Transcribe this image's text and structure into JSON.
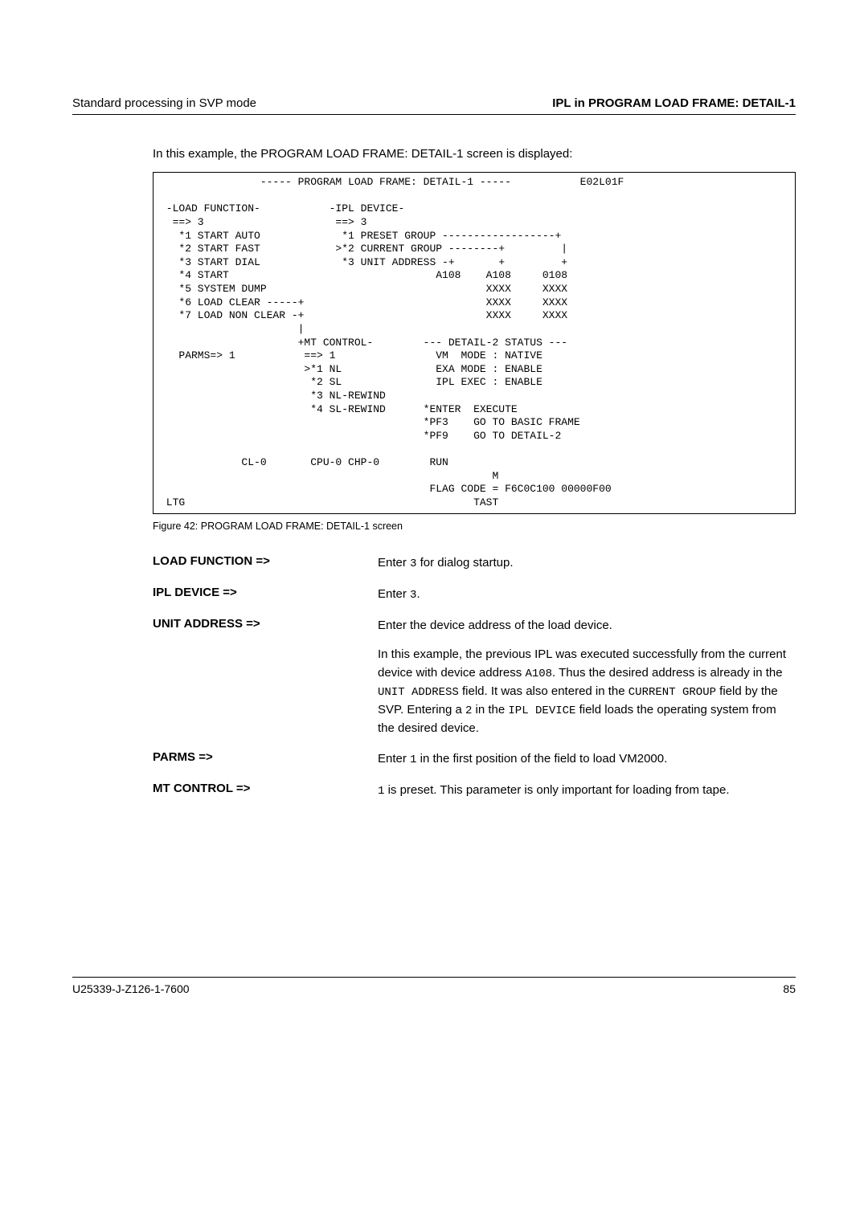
{
  "header": {
    "left": "Standard processing in SVP mode",
    "right": "IPL in PROGRAM LOAD FRAME: DETAIL-1"
  },
  "intro": "In this example, the PROGRAM LOAD FRAME: DETAIL-1 screen is displayed:",
  "terminal": "                ----- PROGRAM LOAD FRAME: DETAIL-1 -----           E02L01F\n\n -LOAD FUNCTION-           -IPL DEVICE-\n  ==> 3                     ==> 3\n   *1 START AUTO             *1 PRESET GROUP ------------------+\n   *2 START FAST            >*2 CURRENT GROUP --------+         |\n   *3 START DIAL             *3 UNIT ADDRESS -+       +         +\n   *4 START                                 A108    A108     0108\n   *5 SYSTEM DUMP                                   XXXX     XXXX\n   *6 LOAD CLEAR -----+                             XXXX     XXXX\n   *7 LOAD NON CLEAR -+                             XXXX     XXXX\n                      |\n                      +MT CONTROL-        --- DETAIL-2 STATUS ---\n   PARMS=> 1           ==> 1                VM  MODE : NATIVE\n                       >*1 NL               EXA MODE : ENABLE\n                        *2 SL               IPL EXEC : ENABLE\n                        *3 NL-REWIND\n                        *4 SL-REWIND      *ENTER  EXECUTE\n                                          *PF3    GO TO BASIC FRAME\n                                          *PF9    GO TO DETAIL-2\n\n             CL-0       CPU-0 CHP-0        RUN\n                                                     M\n                                           FLAG CODE = F6C0C100 00000F00\n LTG                                              TAST",
  "figcaption": "Figure 42:  PROGRAM LOAD FRAME:  DETAIL-1 screen",
  "defs": {
    "load_function": {
      "term": "LOAD FUNCTION =>",
      "desc_pre": "Enter ",
      "code": "3",
      "desc_post": " for dialog startup."
    },
    "ipl_device": {
      "term": "IPL DEVICE =>",
      "desc_pre": "Enter ",
      "code": "3",
      "desc_post": "."
    },
    "unit_address": {
      "term": "UNIT ADDRESS =>",
      "p1": "Enter the device address of the load device.",
      "p2_1": "In this example, the previous IPL was executed successfully from the current device with device address ",
      "p2_c1": "A108",
      "p2_2": ". Thus the desired address is already in the ",
      "p2_c2": "UNIT ADDRESS",
      "p2_3": " field. It was also entered in the ",
      "p2_c3": "CURRENT GROUP",
      "p2_4": " field by the SVP. Entering a ",
      "p2_c4": "2",
      "p2_5": " in the ",
      "p2_c5": "IPL DEVICE",
      "p2_6": " field loads the operating system from the desired device."
    },
    "parms": {
      "term": "PARMS =>",
      "d_pre": "Enter ",
      "d_code": "1",
      "d_post": " in the first position of the field to load VM2000."
    },
    "mt_control": {
      "term": "MT CONTROL =>",
      "d_code": "1",
      "d_post": " is preset. This parameter is only important for loading from tape."
    }
  },
  "footer": {
    "left": "U25339-J-Z126-1-7600",
    "right": "85"
  }
}
